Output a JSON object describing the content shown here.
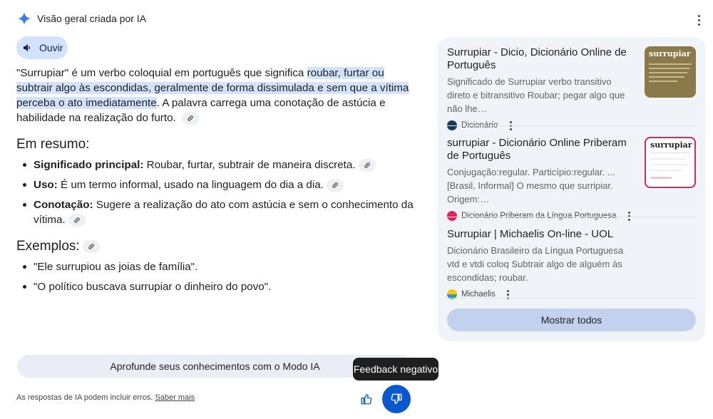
{
  "header": {
    "title": "Visão geral criada por IA",
    "icon": "ai-sparkle-icon",
    "menu_icon": "more-vert-icon"
  },
  "listen_button": {
    "label": "Ouvir",
    "icon": "speaker-icon"
  },
  "main": {
    "intro": {
      "before": "\"Surrupiar\" é um verbo coloquial em português que significa ",
      "highlight": "roubar, furtar ou subtrair algo às escondidas, geralmente de forma dissimulada e sem que a vítima perceba o ato imediatamente",
      "after": ". A palavra carrega uma conotação de astúcia e habilidade na realização do furto."
    },
    "summary_heading": "Em resumo:",
    "summary_items": [
      {
        "term": "Significado principal:",
        "text": " Roubar, furtar, subtrair de maneira discreta."
      },
      {
        "term": "Uso:",
        "text": " É um termo informal, usado na linguagem do dia a dia."
      },
      {
        "term": "Conotação:",
        "text": " Sugere a realização do ato com astúcia e sem o conhecimento da vítima."
      }
    ],
    "examples_heading": "Exemplos:",
    "examples": [
      "\"Ele surrupiou as joias de família\".",
      "\"O político buscava surrupiar o dinheiro do povo\"."
    ]
  },
  "deep_dive_button": "Aprofunde seus conhecimentos com o Modo IA",
  "disclaimer": {
    "text": "As respostas de IA podem incluir erros. ",
    "link": "Saber mais"
  },
  "feedback": {
    "tooltip": "Feedback negativo",
    "up_icon": "thumbs-up-icon",
    "down_icon": "thumbs-down-icon"
  },
  "sources": [
    {
      "title": "Surrupiar - Dicio, Dicionário Online de Português",
      "description": "Significado de Surrupiar verbo transitivo direto e bitransitivo Roubar; pegar algo que não lhe…",
      "site": "Dicionário",
      "thumb_word": "surrupiar",
      "favicon_color": "#1a3a5c"
    },
    {
      "title": "surrupiar - Dicionário Online Priberam de Português",
      "description": "Conjugação:regular. Particípio:regular. ... [Brasil, Informal] O mesmo que surripiar. Origem:…",
      "site": "Dicionário Priberam da Língua Portuguesa",
      "thumb_word": "surrupiar",
      "favicon_color": "#e0245e"
    },
    {
      "title": "Surrupiar | Michaelis On-line - UOL",
      "description": "Dicionário Brasileiro da Língua Portuguesa vtd e vtdi coloq Subtrair algo de alguém às escondidas; roubar.",
      "site": "Michaelis",
      "favicon_color": "#f5c518"
    }
  ],
  "show_all_button": "Mostrar todos",
  "colors": {
    "accent": "#0b57d0",
    "highlight": "#d3e3fd",
    "sidebar_bg": "#f0f4f9",
    "show_all_bg": "#c2d2ee"
  }
}
